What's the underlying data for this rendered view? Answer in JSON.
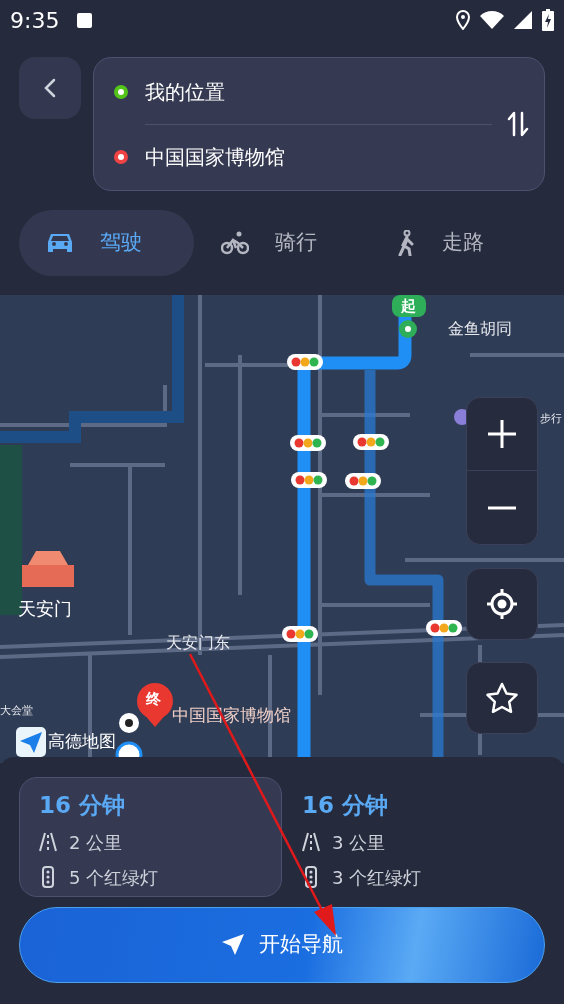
{
  "status_bar": {
    "time": "9:35"
  },
  "route_input": {
    "origin": "我的位置",
    "destination": "中国国家博物馆"
  },
  "modes": [
    {
      "kind": "car",
      "label": "驾驶",
      "selected": true
    },
    {
      "kind": "bike",
      "label": "骑行",
      "selected": false
    },
    {
      "kind": "walk",
      "label": "走路",
      "selected": false
    }
  ],
  "map": {
    "start_marker": "起",
    "end_marker": "终",
    "logo": "高德地图",
    "labels": [
      {
        "kind": "street",
        "text": "金鱼胡同"
      },
      {
        "kind": "poi",
        "text": "步行"
      },
      {
        "kind": "landmark",
        "text": "天安门"
      },
      {
        "kind": "street",
        "text": "天安门东"
      },
      {
        "kind": "poi",
        "text": "大会堂"
      },
      {
        "kind": "destination",
        "text": "中国国家博物馆"
      }
    ]
  },
  "route_options": [
    {
      "duration": "16 分钟",
      "distance": "2 公里",
      "traffic_lights": "5 个红绿灯",
      "selected": true
    },
    {
      "duration": "16 分钟",
      "distance": "3 公里",
      "traffic_lights": "3 个红绿灯",
      "selected": false
    }
  ],
  "start_button": "开始导航"
}
